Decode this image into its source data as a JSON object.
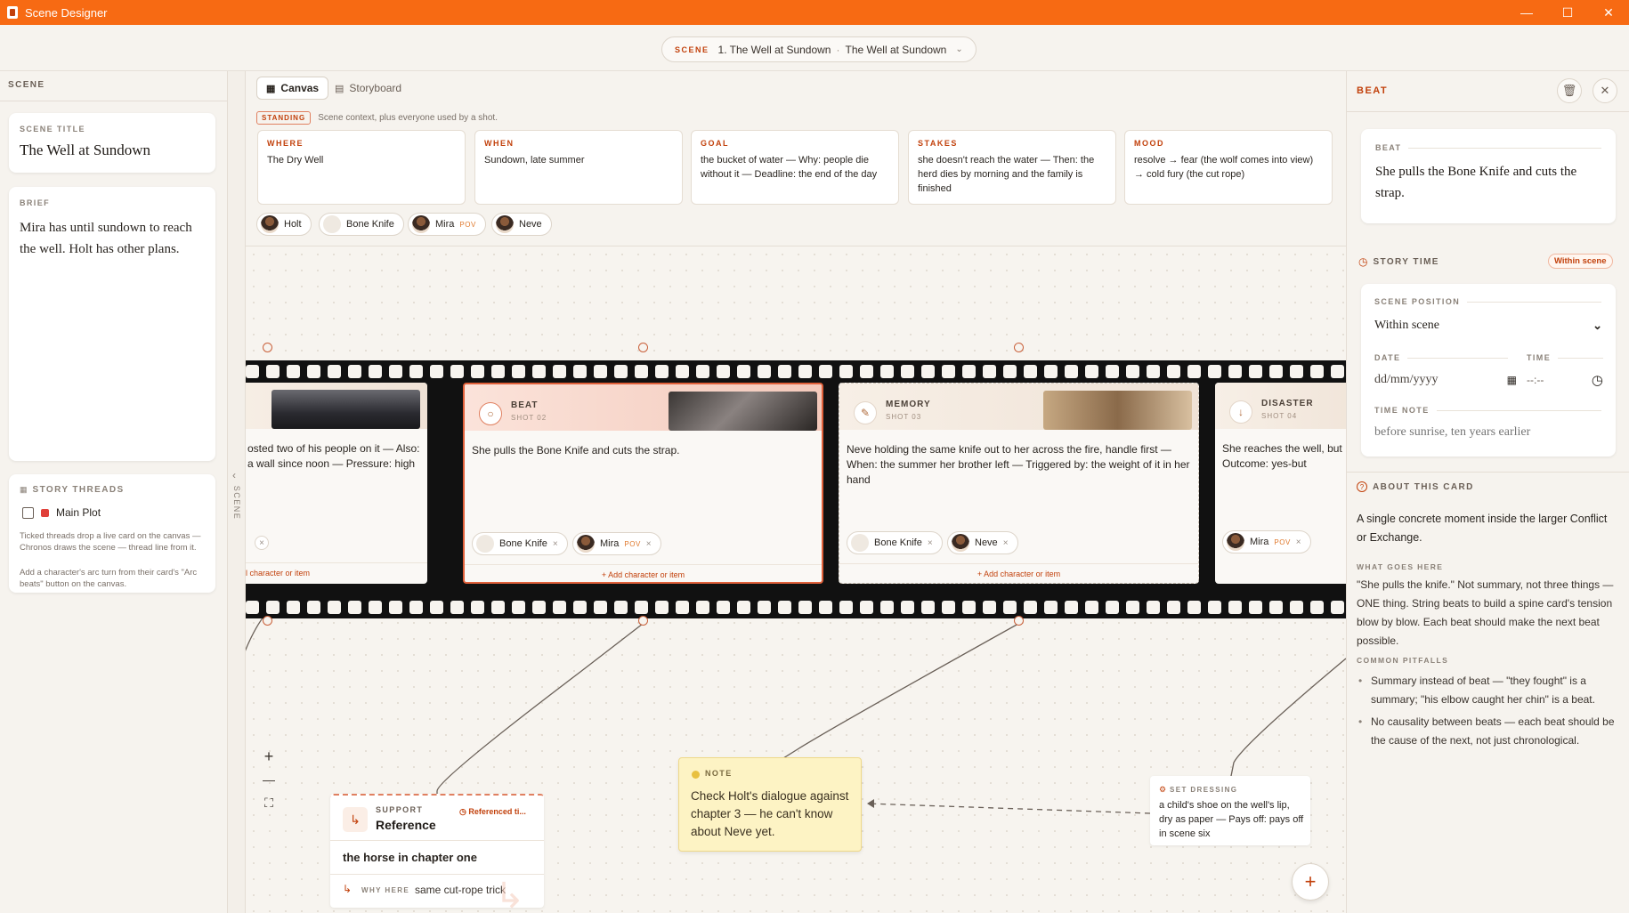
{
  "window": {
    "title": "Scene Designer",
    "minimize": "—",
    "maximize": "☐",
    "close": "✕"
  },
  "scene_selector": {
    "kicker": "SCENE",
    "index_label": "1. The Well at Sundown",
    "separator": "·",
    "current": "The Well at Sundown"
  },
  "left": {
    "section": "SCENE",
    "title_label": "SCENE TITLE",
    "title_value": "The Well at Sundown",
    "brief_label": "BRIEF",
    "brief_value": "Mira has until sundown to reach the well. Holt has other plans.",
    "threads_label": "STORY THREADS",
    "threads": [
      {
        "name": "Main Plot",
        "checked": false,
        "color": "#e0403a"
      }
    ],
    "help1": "Ticked threads drop a live card on the canvas — Chronos draws the scene — thread line from it.",
    "help2": "Add a character's arc turn from their card's \"Arc beats\" button on the canvas."
  },
  "rail": {
    "label": "SCENE",
    "toggle": "‹"
  },
  "tabs": [
    {
      "label": "Canvas",
      "active": true
    },
    {
      "label": "Storyboard",
      "active": false
    }
  ],
  "standing": {
    "badge": "STANDING",
    "caption": "Scene context, plus everyone used by a shot."
  },
  "context": [
    {
      "label": "WHERE",
      "text": "The Dry Well"
    },
    {
      "label": "WHEN",
      "text": "Sundown, late summer"
    },
    {
      "label": "GOAL",
      "text": "the bucket of water — Why: people die without it — Deadline: the end of the day"
    },
    {
      "label": "STAKES",
      "text": "she doesn't reach the water — Then: the herd dies by morning and the family is finished"
    },
    {
      "label": "MOOD",
      "text": "resolve → fear (the wolf comes into view) → cold fury (the cut rope)"
    }
  ],
  "cast": [
    {
      "name": "Holt",
      "pov": ""
    },
    {
      "name": "Bone Knife",
      "pov": ""
    },
    {
      "name": "Mira",
      "pov": "POV"
    },
    {
      "name": "Neve",
      "pov": ""
    }
  ],
  "shots": [
    {
      "type": "",
      "num": "",
      "text": "osted two of his people on it — Also: a wall since noon — Pressure: high",
      "chips": [],
      "add": "l character or item"
    },
    {
      "type": "BEAT",
      "num": "SHOT 02",
      "text": "She pulls the Bone Knife and cuts the strap.",
      "chips": [
        {
          "name": "Bone Knife",
          "pov": ""
        },
        {
          "name": "Mira",
          "pov": "POV"
        }
      ],
      "add": "+ Add character or item"
    },
    {
      "type": "MEMORY",
      "num": "SHOT 03",
      "text": "Neve holding the same knife out to her across the fire, handle first — When: the summer her brother left — Triggered by: the weight of it in her hand",
      "chips": [
        {
          "name": "Bone Knife",
          "pov": ""
        },
        {
          "name": "Neve",
          "pov": ""
        }
      ],
      "add": "+ Add character or item"
    },
    {
      "type": "DISASTER",
      "num": "SHOT 04",
      "text": "She reaches the well, but Outcome: yes-but",
      "chips": [
        {
          "name": "Mira",
          "pov": "POV"
        }
      ],
      "add": ""
    }
  ],
  "note": {
    "label": "NOTE",
    "text": "Check Holt's dialogue against chapter 3 — he can't know about Neve yet."
  },
  "support": {
    "kicker": "SUPPORT",
    "title": "Reference",
    "badge": "Referenced ti...",
    "body": "the horse in chapter one",
    "why_label": "WHY HERE",
    "why": "same cut-rope trick"
  },
  "dressing": {
    "label": "SET DRESSING",
    "text": "a child's shoe on the well's lip, dry as paper — Pays off: pays off in scene six"
  },
  "zoom": {
    "in": "+",
    "out": "—",
    "fit": "⛶"
  },
  "fab": "+",
  "right": {
    "section": "BEAT",
    "beat_label": "BEAT",
    "beat_text": "She pulls the Bone Knife and cuts the strap.",
    "story_time": "STORY TIME",
    "story_badge": "Within scene",
    "position_label": "SCENE POSITION",
    "position_value": "Within scene",
    "date_label": "DATE",
    "date_placeholder": "dd/mm/yyyy",
    "time_label": "TIME",
    "time_placeholder": "--:--",
    "note_label": "TIME NOTE",
    "note_placeholder": "before sunrise, ten years earlier",
    "about_label": "ABOUT THIS CARD",
    "about_text": "A single concrete moment inside the larger Conflict or Exchange.",
    "goes_label": "WHAT GOES HERE",
    "goes_text": "\"She pulls the knife.\" Not summary, not three things — ONE thing. String beats to build a spine card's tension blow by blow. Each beat should make the next beat possible.",
    "pitfalls_label": "COMMON PITFALLS",
    "pitfalls": [
      "Summary instead of beat — \"they fought\" is a summary; \"his elbow caught her chin\" is a beat.",
      "No causality between beats — each beat should be the cause of the next, not just chronological."
    ]
  },
  "colors": {
    "accent": "#f76a13",
    "accent_dark": "#c2410c",
    "note_bg": "#fdf3c4"
  }
}
